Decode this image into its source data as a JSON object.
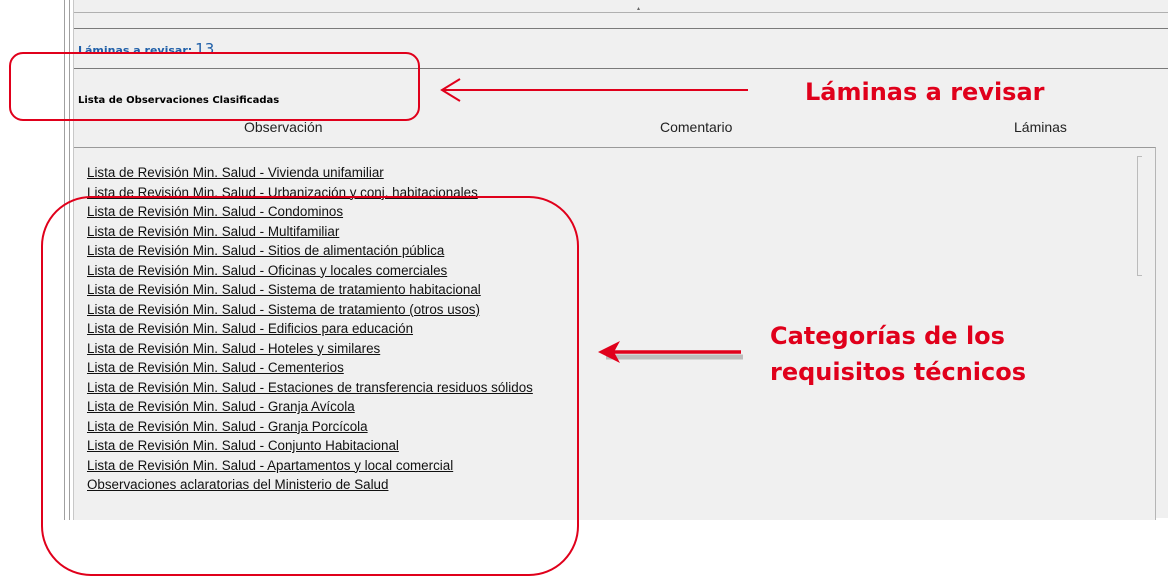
{
  "header": {
    "laminas_label": "Láminas a revisar:",
    "laminas_count": "13"
  },
  "section": {
    "title": "Lista de Observaciones Clasificadas"
  },
  "columns": {
    "observacion": "Observación",
    "comentario": "Comentario",
    "laminas": "Láminas"
  },
  "list": {
    "items": [
      "Lista de Revisión Min. Salud - Vivienda unifamiliar",
      "Lista de Revisión Min. Salud - Urbanización y conj. habitacionales",
      "Lista de Revisión Min. Salud - Condominos",
      "Lista de Revisión Min. Salud - Multifamiliar",
      "Lista de Revisión Min. Salud - Sitios de alimentación pública",
      "Lista de Revisión Min. Salud - Oficinas y locales comerciales",
      "Lista de Revisión Min. Salud - Sistema de tratamiento habitacional",
      "Lista de Revisión Min. Salud - Sistema de tratamiento (otros usos)",
      "Lista de Revisión Min. Salud - Edificios para educación",
      "Lista de Revisión Min. Salud - Hoteles y similares",
      "Lista de Revisión Min. Salud - Cementerios",
      "Lista de Revisión Min. Salud - Estaciones de transferencia residuos sólidos",
      "Lista de Revisión Min. Salud - Granja Avícola",
      "Lista de Revisión Min. Salud - Granja Porcícola",
      "Lista de Revisión Min. Salud - Conjunto Habitacional",
      "Lista de Revisión Min. Salud - Apartamentos y local comercial",
      "Observaciones aclaratorias del Ministerio de Salud"
    ]
  },
  "annotations": {
    "label_1": "Láminas a revisar",
    "label_2_line1": "Categorías de los",
    "label_2_line2": "requisitos técnicos",
    "color": "#e0001b"
  }
}
